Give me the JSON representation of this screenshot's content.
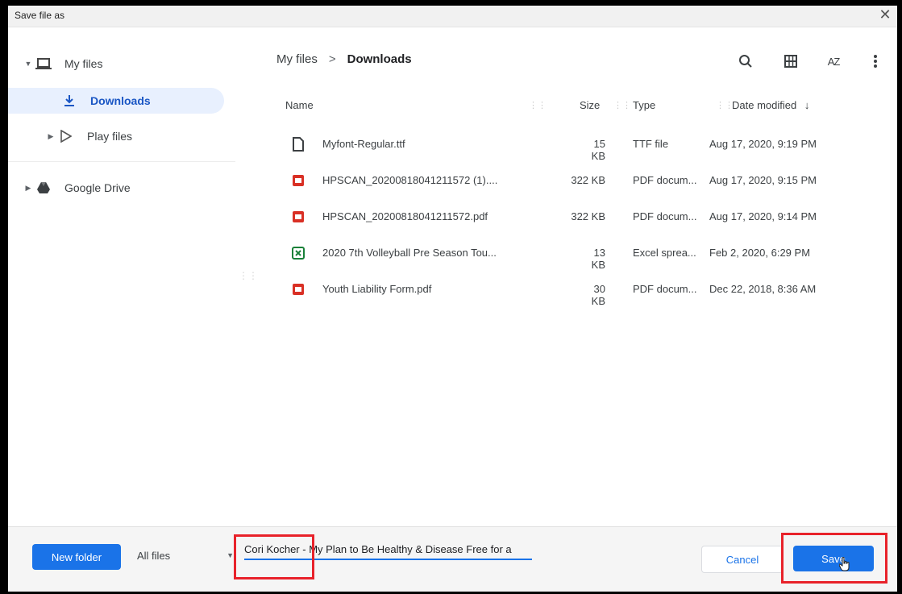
{
  "dialog": {
    "title": "Save file as",
    "close_glyph": "✕"
  },
  "sidebar": {
    "my_files": "My files",
    "downloads": "Downloads",
    "play_files": "Play files",
    "google_drive": "Google Drive"
  },
  "breadcrumb": {
    "root": "My files",
    "separator": ">",
    "current": "Downloads"
  },
  "toolbar": {
    "search_icon": "search-icon",
    "grid_icon": "grid-view-icon",
    "sort_label": "AZ",
    "more_icon": "more-vert-icon"
  },
  "columns": {
    "name": "Name",
    "size": "Size",
    "type": "Type",
    "date": "Date modified",
    "sort_arrow": "↓"
  },
  "files": [
    {
      "name": "Myfont-Regular.ttf",
      "size": "15 KB",
      "type": "TTF file",
      "date": "Aug 17, 2020, 9:19 PM",
      "icon": "file-icon"
    },
    {
      "name": "HPSCAN_20200818041211572 (1)....",
      "size": "322 KB",
      "type": "PDF docum...",
      "date": "Aug 17, 2020, 9:15 PM",
      "icon": "pdf-icon"
    },
    {
      "name": "HPSCAN_20200818041211572.pdf",
      "size": "322 KB",
      "type": "PDF docum...",
      "date": "Aug 17, 2020, 9:14 PM",
      "icon": "pdf-icon"
    },
    {
      "name": "2020 7th Volleyball Pre Season Tou...",
      "size": "13 KB",
      "type": "Excel sprea...",
      "date": "Feb 2, 2020, 6:29 PM",
      "icon": "excel-icon"
    },
    {
      "name": "Youth Liability Form.pdf",
      "size": "30 KB",
      "type": "PDF docum...",
      "date": "Dec 22, 2018, 8:36 AM",
      "icon": "pdf-icon"
    }
  ],
  "footer": {
    "new_folder": "New folder",
    "filter": "All files",
    "filename": "Cori Kocher - My Plan to Be Healthy & Disease Free for a",
    "cancel": "Cancel",
    "save": "Save"
  },
  "colors": {
    "accent": "#1a73e8",
    "highlight_box": "#e8222a",
    "pdf": "#d93025",
    "excel": "#188038"
  }
}
